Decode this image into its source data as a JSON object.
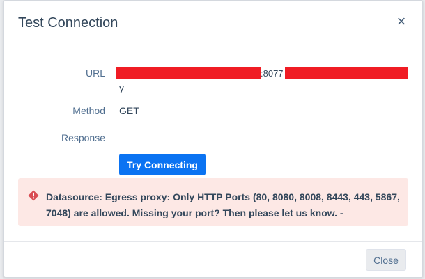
{
  "modal": {
    "title": "Test Connection",
    "close_icon": "×"
  },
  "fields": {
    "url_label": "URL",
    "url_port": ":8077",
    "url_wrap": "y",
    "method_label": "Method",
    "method_value": "GET",
    "response_label": "Response",
    "response_value": ""
  },
  "actions": {
    "try_label": "Try Connecting",
    "close_label": "Close"
  },
  "alert": {
    "icon": "warning-icon",
    "message": "Datasource: Egress proxy: Only HTTP Ports (80, 8080, 8008, 8443, 443, 5867, 7048) are allowed. Missing your port? Then please let us know. -"
  },
  "colors": {
    "primary": "#0b73f2",
    "alert_bg": "#fde8e5",
    "alert_icon": "#d94c53",
    "redaction": "#f01c24"
  }
}
